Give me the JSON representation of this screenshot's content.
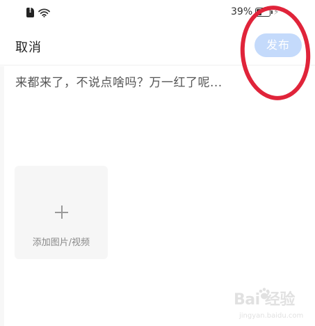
{
  "status_bar": {
    "battery_percent_text": "39%",
    "battery_level": 0.39,
    "charge_glyph": "⚡",
    "icons": [
      "sim-alert-icon",
      "wifi-icon",
      "battery-icon"
    ]
  },
  "header": {
    "cancel_label": "取消",
    "publish_label": "发布"
  },
  "compose": {
    "placeholder": "来都来了，不说点啥吗？万一红了呢..."
  },
  "media": {
    "add_label": "添加图片/视频",
    "add_icon": "plus-icon"
  },
  "watermark": {
    "brand": "Bai  经验",
    "sub": "jingyan.baidu.com"
  },
  "colors": {
    "publish_button_bg": "#c4dafb",
    "annotation_red": "#e0243a"
  }
}
